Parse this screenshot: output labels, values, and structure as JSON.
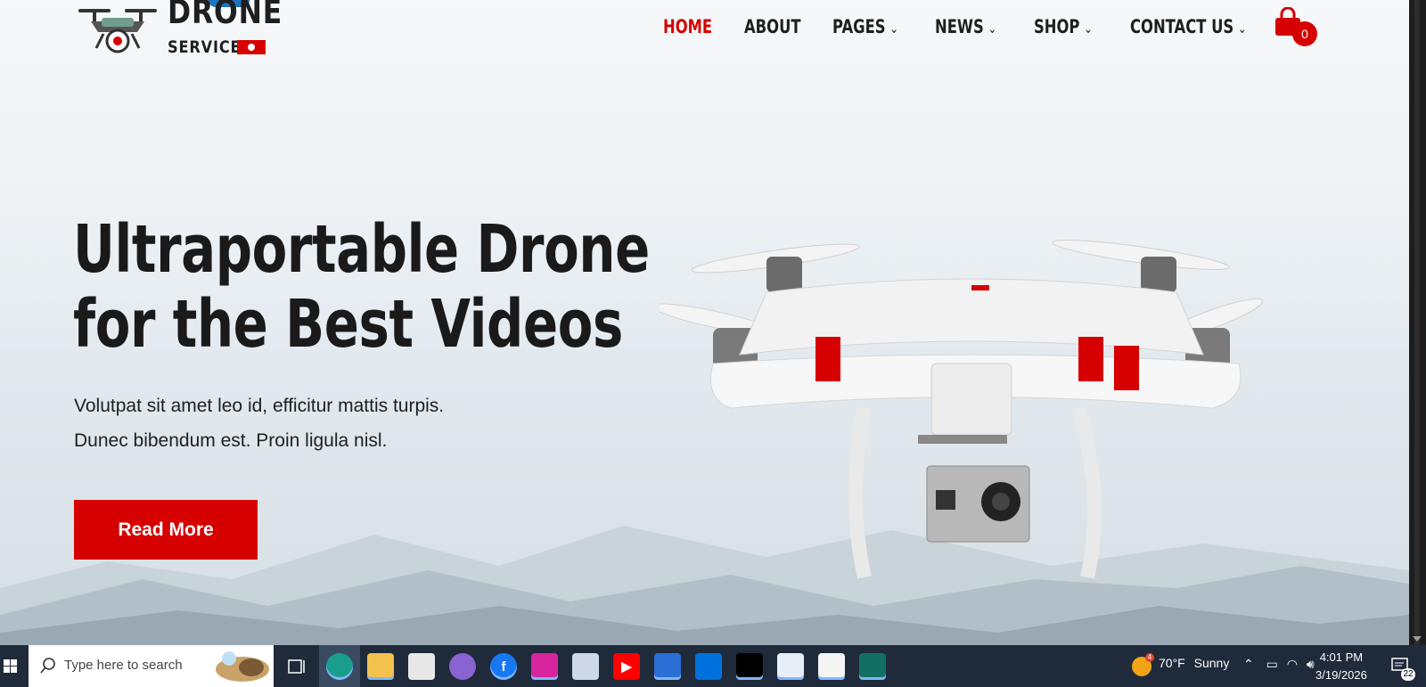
{
  "site": {
    "logo_title": "DRONE",
    "logo_subtitle": "SERVICE"
  },
  "nav": {
    "items": [
      {
        "label": "HOME",
        "active": true,
        "has_dropdown": false
      },
      {
        "label": "ABOUT",
        "active": false,
        "has_dropdown": false
      },
      {
        "label": "PAGES",
        "active": false,
        "has_dropdown": true
      },
      {
        "label": "NEWS",
        "active": false,
        "has_dropdown": true
      },
      {
        "label": "SHOP",
        "active": false,
        "has_dropdown": true
      },
      {
        "label": "CONTACT US",
        "active": false,
        "has_dropdown": true
      }
    ],
    "cart_count": "0",
    "chevron": "⌄"
  },
  "hero": {
    "title_line1": "Ultraportable Drone",
    "title_line2": "for the Best Videos",
    "desc_line1": "Volutpat sit amet leo id, efficitur mattis turpis.",
    "desc_line2": "Dunec bibendum est. Proin ligula nisl.",
    "button_label": "Read More"
  },
  "colors": {
    "accent": "#d60000",
    "text_dark": "#1a1a1a",
    "taskbar": "#1f2a3a"
  },
  "taskbar": {
    "search_placeholder": "Type here to search",
    "apps": [
      "task-view-icon",
      "edge-icon",
      "file-explorer-icon",
      "store-icon",
      "copilot-icon",
      "facebook-icon",
      "instagram-icon",
      "paint-icon",
      "youtube-icon",
      "mail-icon",
      "walmart-icon",
      "audio-app-icon",
      "notepad-icon",
      "store-bag-icon",
      "network-app-icon"
    ],
    "weather_temp": "70°F",
    "weather_desc": "Sunny",
    "weather_badge": "4",
    "time": "4:01 PM",
    "date": "3/19/2026",
    "notification_count": "22"
  }
}
